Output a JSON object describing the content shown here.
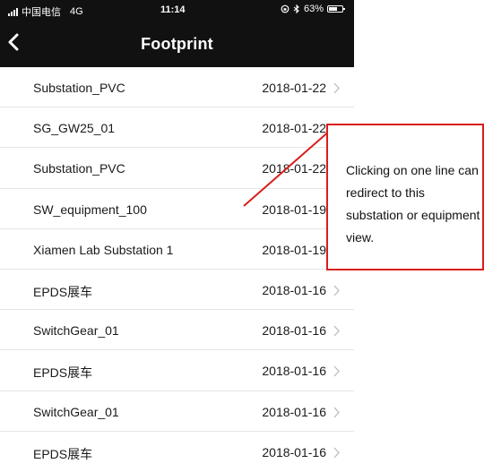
{
  "status_bar": {
    "carrier": "中国电信",
    "network": "4G",
    "time": "11:14",
    "battery_percent": "63%",
    "battery_level": 0.63
  },
  "header": {
    "title": "Footprint",
    "back_icon": "chevron-left-icon"
  },
  "list": [
    {
      "name": "Substation_PVC",
      "date": "2018-01-22"
    },
    {
      "name": "SG_GW25_01",
      "date": "2018-01-22"
    },
    {
      "name": "Substation_PVC",
      "date": "2018-01-22"
    },
    {
      "name": "SW_equipment_100",
      "date": "2018-01-19"
    },
    {
      "name": "Xiamen Lab Substation 1",
      "date": "2018-01-19"
    },
    {
      "name": "EPDS展车",
      "date": "2018-01-16"
    },
    {
      "name": "SwitchGear_01",
      "date": "2018-01-16"
    },
    {
      "name": "EPDS展车",
      "date": "2018-01-16"
    },
    {
      "name": "SwitchGear_01",
      "date": "2018-01-16"
    },
    {
      "name": "EPDS展车",
      "date": "2018-01-16"
    }
  ],
  "annotation": {
    "text": "Clicking on one line can redirect to this substation or equipment view.",
    "color": "#d91d1d"
  }
}
